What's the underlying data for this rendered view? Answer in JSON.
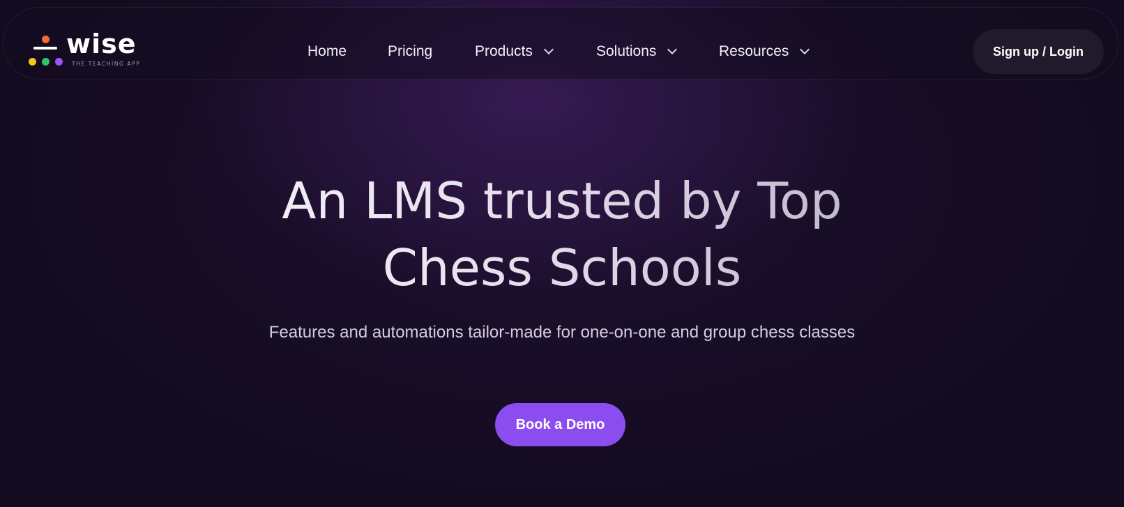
{
  "brand": {
    "name": "wise",
    "tagline": "THE TEACHING APP",
    "logo_colors": {
      "head": "#f06a3c",
      "bar": "#ffffff",
      "dot_yellow": "#f7c51e",
      "dot_green": "#2ec46e",
      "dot_purple": "#9a55f5"
    }
  },
  "nav": {
    "items": [
      {
        "label": "Home",
        "dropdown": false
      },
      {
        "label": "Pricing",
        "dropdown": false
      },
      {
        "label": "Products",
        "dropdown": true
      },
      {
        "label": "Solutions",
        "dropdown": true
      },
      {
        "label": "Resources",
        "dropdown": true
      }
    ],
    "cta_label": "Sign up / Login"
  },
  "hero": {
    "title_line1": "An LMS trusted by Top",
    "title_line2": "Chess Schools",
    "subtitle": "Features and automations tailor-made for one-on-one and group chess classes",
    "button_label": "Book a Demo"
  },
  "colors": {
    "background": "#130b1f",
    "accent": "#8b4cf0",
    "cta_bg": "#211a2c"
  },
  "icons": {
    "dropdown": "chevron-down-icon"
  }
}
